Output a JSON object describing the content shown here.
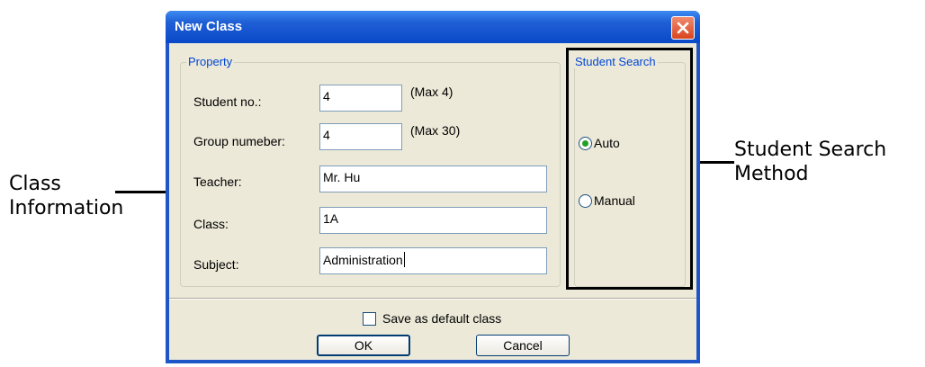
{
  "window": {
    "title": "New Class"
  },
  "property": {
    "legend": "Property",
    "student_no": {
      "label": "Student no.:",
      "value": "4",
      "hint": "(Max 4)"
    },
    "group_number": {
      "label": "Group numeber:",
      "value": "4",
      "hint": "(Max 30)"
    },
    "teacher": {
      "label": "Teacher:",
      "value": "Mr. Hu"
    },
    "class": {
      "label": "Class:",
      "value": "1A"
    },
    "subject": {
      "label": "Subject:",
      "value": "Administration"
    }
  },
  "student_search": {
    "legend": "Student Search",
    "options": [
      {
        "label": "Auto",
        "selected": true
      },
      {
        "label": "Manual",
        "selected": false
      }
    ]
  },
  "save_default": {
    "label": "Save as default class",
    "checked": false
  },
  "buttons": {
    "ok": "OK",
    "cancel": "Cancel"
  },
  "annotations": {
    "left": [
      "Class",
      "Information"
    ],
    "right": [
      "Student Search",
      "Method"
    ]
  }
}
